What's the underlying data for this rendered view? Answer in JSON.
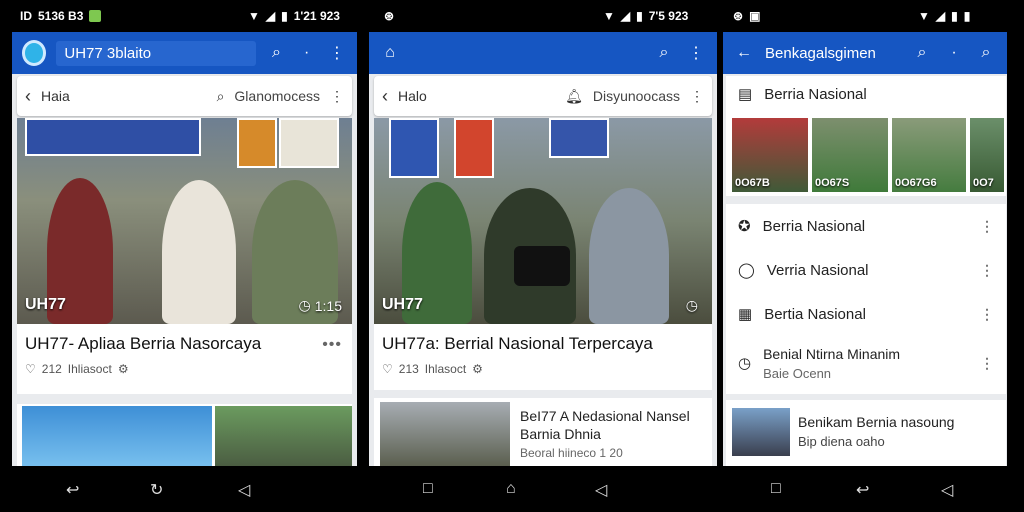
{
  "statusbar": {
    "left_text": "5136 B3",
    "center_time": "1'21 923",
    "right_time": "7'5 923"
  },
  "panel1": {
    "appbar_title": "UH77 3blaito",
    "search": {
      "query": "Haia",
      "hint": "Glanomocess"
    },
    "hero": {
      "label": "UH77",
      "time": "1:15"
    },
    "card": {
      "headline": "UH77- Apliaa Berria Nasorcaya",
      "meta_count": "212",
      "meta_text": "Ihliasoct"
    }
  },
  "panel2": {
    "search": {
      "query": "Halo",
      "hint": "Disyunoocass"
    },
    "hero": {
      "label": "UH77",
      "time": ""
    },
    "card": {
      "headline": "UH77a: Berrial Nasional Terpercaya",
      "meta_count": "213",
      "meta_text": "Ihlasoct"
    },
    "item": {
      "title": "BeI77 A Nedasional Nansel",
      "subtitle": "Barnia Dhnia",
      "meta": "Beoral hiineco 1 20"
    }
  },
  "panel3": {
    "appbar_title": "Benkagalsgimen",
    "section_title": "Berria Nasional",
    "thumbs": [
      "0O67B",
      "0O67S",
      "0O67G6",
      "0O7"
    ],
    "list": [
      {
        "label": "Berria Nasional",
        "icon": "badge-icon"
      },
      {
        "label": "Verria Nasional",
        "icon": "chat-icon"
      },
      {
        "label": "Bertia Nasional",
        "icon": "calendar-icon"
      },
      {
        "label": "Benial Ntirna Minanim",
        "sub": "Baie Ocenn",
        "icon": "clock-icon"
      }
    ],
    "bottom_item": {
      "title": "Benikam Bernia nasoung",
      "sub": "Bip diena oaho"
    }
  },
  "colors": {
    "brand_blue": "#1656c2",
    "background": "#e9ebee"
  }
}
